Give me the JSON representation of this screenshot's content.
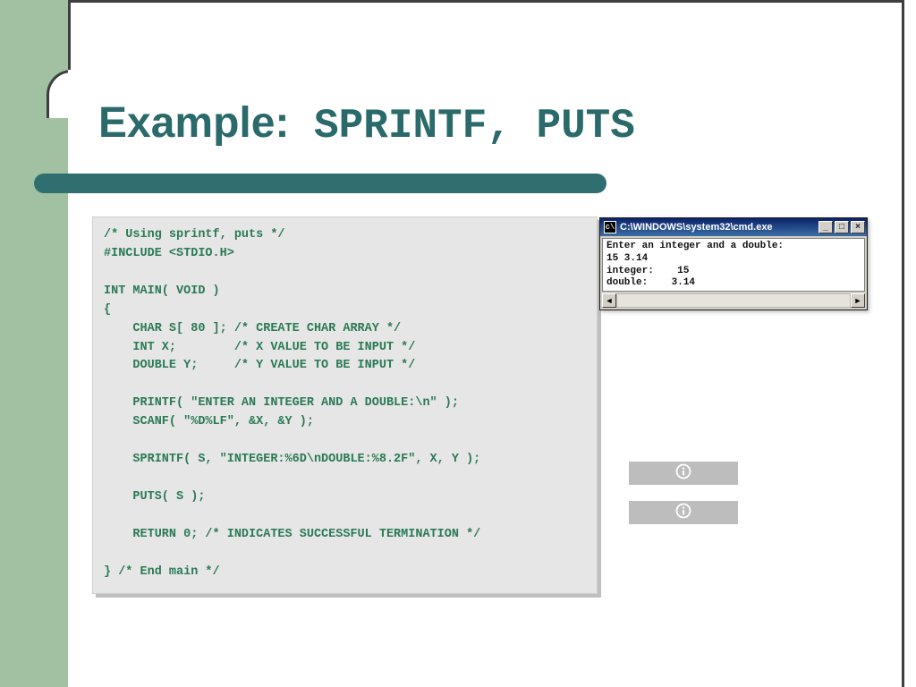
{
  "colors": {
    "accent": "#2b6a6a",
    "leftStripe": "#a2c1a2",
    "codeText": "#2a7a55",
    "cardBg": "#e6e6e6"
  },
  "title": {
    "heading": "Example:",
    "code": " SPRINTF, PUTS"
  },
  "code": {
    "text": "/* Using sprintf, puts */\n#INCLUDE <STDIO.H>\n\nINT MAIN( VOID )\n{\n    CHAR S[ 80 ]; /* CREATE CHAR ARRAY */\n    INT X;        /* X VALUE TO BE INPUT */\n    DOUBLE Y;     /* Y VALUE TO BE INPUT */\n\n    PRINTF( \"ENTER AN INTEGER AND A DOUBLE:\\n\" );\n    SCANF( \"%D%LF\", &X, &Y );\n\n    SPRINTF( S, \"INTEGER:%6D\\nDOUBLE:%8.2F\", X, Y );\n\n    PUTS( S );\n\n    RETURN 0; /* INDICATES SUCCESSFUL TERMINATION */\n\n} /* End main */"
  },
  "cmd": {
    "iconGlyph": "c\\",
    "title": "C:\\WINDOWS\\system32\\cmd.exe",
    "minimize": "_",
    "maximize": "□",
    "close": "×",
    "output": "Enter an integer and a double:\n15 3.14\ninteger:    15\ndouble:    3.14",
    "scrollLeft": "◄",
    "scrollRight": "►"
  },
  "pills": {
    "iconName": "info-icon"
  }
}
